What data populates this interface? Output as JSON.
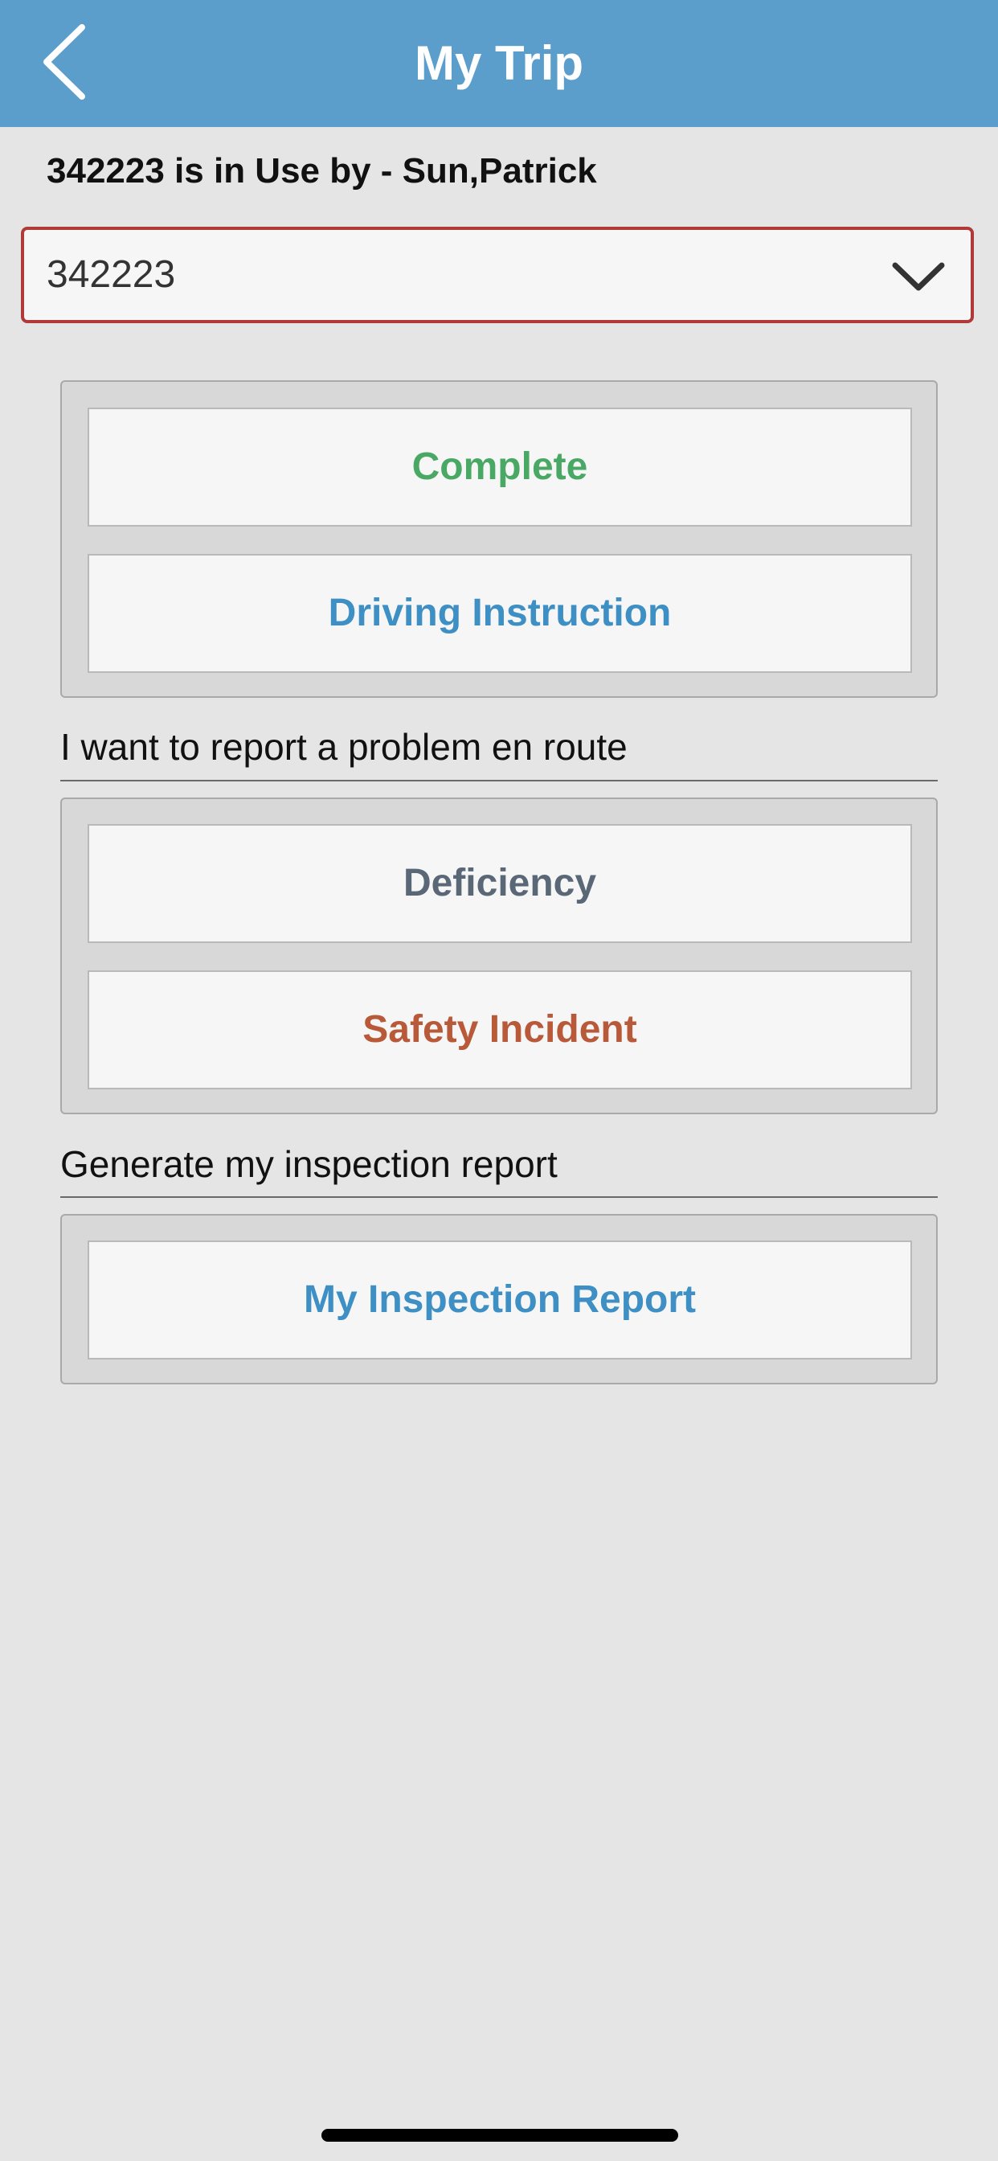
{
  "header": {
    "title": "My Trip",
    "back_icon": "chevron-left-icon",
    "background_color": "#5b9dcb"
  },
  "status": {
    "text": "342223 is in Use by - Sun,Patrick"
  },
  "vehicle_select": {
    "value": "342223",
    "icon": "chevron-down-icon",
    "border_color": "#b03a3a"
  },
  "actions": {
    "complete_label": "Complete",
    "complete_color": "#4aa865",
    "driving_instruction_label": "Driving Instruction",
    "driving_instruction_color": "#3d8fc4"
  },
  "problem_section": {
    "label": "I want to report a problem en route",
    "deficiency_label": "Deficiency",
    "deficiency_color": "#5a6776",
    "safety_incident_label": "Safety Incident",
    "safety_incident_color": "#b85a3a"
  },
  "report_section": {
    "label": "Generate my inspection report",
    "inspection_report_label": "My Inspection Report",
    "inspection_report_color": "#3d8fc4"
  }
}
